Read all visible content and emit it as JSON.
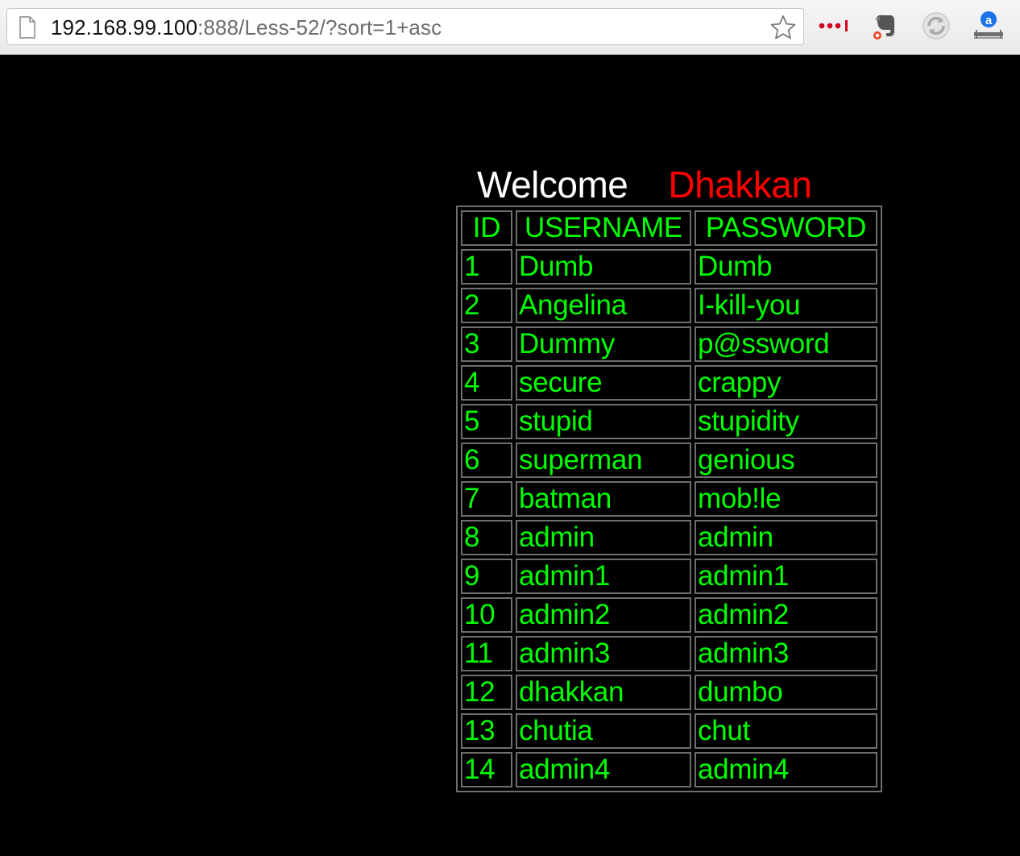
{
  "browser": {
    "url_host": "192.168.99.100",
    "url_rest": ":888/Less-52/?sort=1+asc",
    "extensions": [
      "more-icon",
      "evernote-icon",
      "sync-icon",
      "translate-icon"
    ]
  },
  "page": {
    "welcome": "Welcome",
    "name": "Dhakkan",
    "colors": {
      "background": "#000000",
      "text": "#00ff00",
      "name": "#ff0000",
      "welcome": "#ffffff"
    },
    "headers": [
      "ID",
      "USERNAME",
      "PASSWORD"
    ],
    "rows": [
      {
        "id": "1",
        "username": "Dumb",
        "password": "Dumb"
      },
      {
        "id": "2",
        "username": "Angelina",
        "password": "I-kill-you"
      },
      {
        "id": "3",
        "username": "Dummy",
        "password": "p@ssword"
      },
      {
        "id": "4",
        "username": "secure",
        "password": "crappy"
      },
      {
        "id": "5",
        "username": "stupid",
        "password": "stupidity"
      },
      {
        "id": "6",
        "username": "superman",
        "password": "genious"
      },
      {
        "id": "7",
        "username": "batman",
        "password": "mob!le"
      },
      {
        "id": "8",
        "username": "admin",
        "password": "admin"
      },
      {
        "id": "9",
        "username": "admin1",
        "password": "admin1"
      },
      {
        "id": "10",
        "username": "admin2",
        "password": "admin2"
      },
      {
        "id": "11",
        "username": "admin3",
        "password": "admin3"
      },
      {
        "id": "12",
        "username": "dhakkan",
        "password": "dumbo"
      },
      {
        "id": "13",
        "username": "chutia",
        "password": "chut"
      },
      {
        "id": "14",
        "username": "admin4",
        "password": "admin4"
      }
    ]
  }
}
